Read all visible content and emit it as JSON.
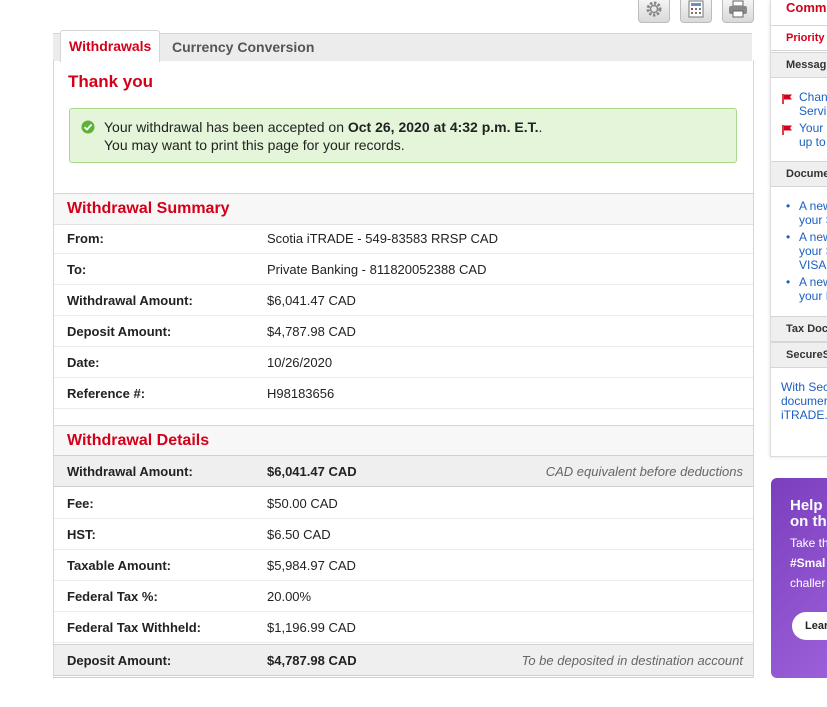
{
  "toolbar": {
    "icons": [
      "gear-icon",
      "calculator-icon",
      "printer-icon"
    ]
  },
  "tabs": [
    {
      "label": "Withdrawals",
      "active": true
    },
    {
      "label": "Currency Conversion",
      "active": false
    }
  ],
  "thank_you": "Thank you",
  "success": {
    "prefix": "Your withdrawal has been accepted on ",
    "date": "Oct 26, 2020 at 4:32 p.m. E.T.",
    "suffix": ".",
    "line2": "You may want to print this page for your records."
  },
  "summary": {
    "title": "Withdrawal Summary",
    "rows": [
      {
        "label": "From:",
        "value": "Scotia iTRADE - 549-83583 RRSP CAD"
      },
      {
        "label": "To:",
        "value": "Private Banking - 811820052388 CAD"
      },
      {
        "label": "Withdrawal Amount:",
        "value": "$6,041.47 CAD"
      },
      {
        "label": "Deposit Amount:",
        "value": "$4,787.98 CAD"
      },
      {
        "label": "Date:",
        "value": "10/26/2020"
      },
      {
        "label": "Reference #:",
        "value": "H98183656"
      }
    ]
  },
  "details": {
    "title": "Withdrawal Details",
    "rows": [
      {
        "label": "Withdrawal Amount:",
        "value": "$6,041.47 CAD",
        "note": "CAD equivalent before deductions"
      },
      {
        "label": "Fee:",
        "value": "$50.00 CAD",
        "note": ""
      },
      {
        "label": "HST:",
        "value": "$6.50 CAD",
        "note": ""
      },
      {
        "label": "Taxable Amount:",
        "value": "$5,984.97 CAD",
        "note": ""
      },
      {
        "label": "Federal Tax %:",
        "value": "20.00%",
        "note": ""
      },
      {
        "label": "Federal Tax Withheld:",
        "value": "$1,196.99 CAD",
        "note": ""
      },
      {
        "label": "Deposit Amount:",
        "value": "$4,787.98 CAD",
        "note": "To be deposited in destination account"
      }
    ]
  },
  "sidebar": {
    "title": "Commu",
    "priority": "Priority",
    "messages_header": "Messag",
    "messages": [
      {
        "line1": "Chan",
        "line2": "Servi"
      },
      {
        "line1": "Your",
        "line2": "up to"
      }
    ],
    "documents_header": "Docume",
    "documents": [
      {
        "line1": "A new",
        "line2": "your S",
        "line3": ""
      },
      {
        "line1": "A new",
        "line2": "your S",
        "line3": "VISA"
      },
      {
        "line1": "A new",
        "line2": "your I",
        "line3": ""
      }
    ],
    "tax_header": "Tax Doc",
    "secure_header": "SecureS",
    "secure_text": [
      "With Sec",
      "documer",
      "iTRADE."
    ]
  },
  "promo": {
    "heading": [
      "Help",
      "on th"
    ],
    "line1": "Take th",
    "line2": "#Smal",
    "line3": "challer",
    "button": "Lear"
  },
  "colors": {
    "brand_red": "#d4001a",
    "success_bg": "#e4f5da",
    "link_blue": "#1d5fbf",
    "promo_purple": "#8a4fcc"
  }
}
